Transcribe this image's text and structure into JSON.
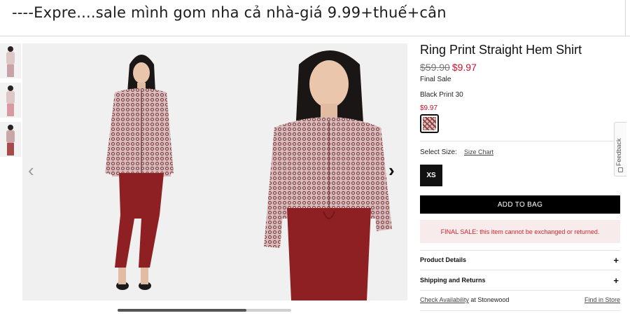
{
  "post": {
    "title": "----Expre....sale mình gom nha cả nhà-giá 9.99+thuế+cân"
  },
  "gallery": {
    "thumbnails": [
      "thumbnail-1",
      "thumbnail-2",
      "thumbnail-3"
    ],
    "prev_icon": "chevron-left-icon",
    "next_icon": "chevron-right-icon",
    "scroll_progress": 0.74
  },
  "product": {
    "name": "Ring Print Straight Hem Shirt",
    "original_price": "$59.90",
    "sale_price": "$9.97",
    "final_sale_label": "Final Sale",
    "color_name": "Black Print 30",
    "color_price": "$9.97",
    "select_size_label": "Select Size:",
    "size_chart_label": "Size Chart",
    "sizes": [
      "XS"
    ],
    "add_to_bag_label": "ADD TO BAG",
    "final_sale_notice": "FINAL SALE: this item cannot be exchanged or returned.",
    "accordions": [
      {
        "title": "Product Details",
        "icon": "+"
      },
      {
        "title": "Shipping and Returns",
        "icon": "+"
      }
    ],
    "check_availability_label": "Check Availability",
    "store_text": " at Stonewood",
    "find_in_store_label": "Find in Store"
  },
  "feedback": {
    "label": "Feedback"
  },
  "colors": {
    "sale_red": "#c8102e",
    "button_black": "#000000",
    "notice_bg": "#f8ebeb"
  }
}
